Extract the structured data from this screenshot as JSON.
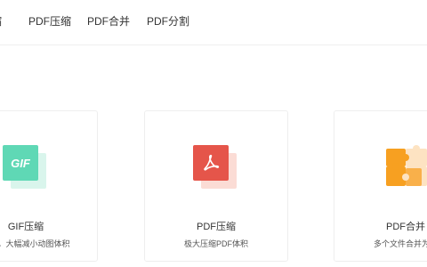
{
  "nav": {
    "items": [
      {
        "label": "缩"
      },
      {
        "label": "PDF压缩"
      },
      {
        "label": "PDF合并"
      },
      {
        "label": "PDF分割"
      }
    ]
  },
  "cards": [
    {
      "title": "GIF压缩",
      "description": "尺寸，大幅减小动图体积",
      "icon": "gif-icon",
      "icon_text": "GIF",
      "colors": {
        "front": "#5fd8b5",
        "back": "#d9f5ec"
      }
    },
    {
      "title": "PDF压缩",
      "description": "极大压缩PDF体积",
      "icon": "pdf-compress-icon",
      "colors": {
        "front": "#e5554a",
        "back": "#fbdcd5"
      }
    },
    {
      "title": "PDF合并",
      "description": "多个文件合并为一",
      "icon": "puzzle-icon",
      "colors": {
        "front": "#f7a021",
        "back": "#fde3c2"
      }
    }
  ]
}
